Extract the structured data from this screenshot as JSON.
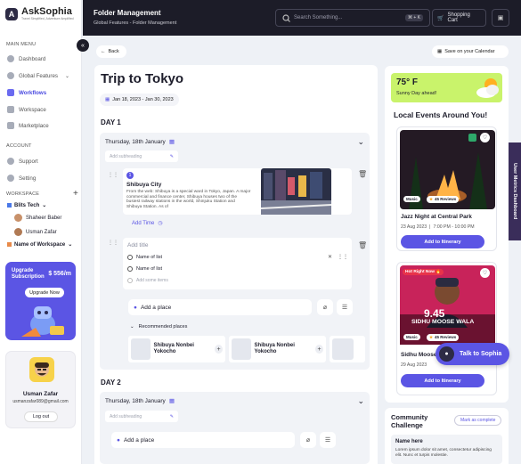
{
  "brand": {
    "name": "AskSophia",
    "tagline": "Travel Simplified, Adventure Amplified"
  },
  "sidebar": {
    "main_menu": "MAIN MENU",
    "main_items": [
      {
        "label": "Dashboard"
      },
      {
        "label": "Global Features"
      },
      {
        "label": "Workflows"
      },
      {
        "label": "Workspace"
      },
      {
        "label": "Marketplace"
      }
    ],
    "account": "ACCOUNT",
    "account_items": [
      {
        "label": "Support"
      },
      {
        "label": "Setting"
      }
    ],
    "workspace": "WORKSPACE",
    "ws1": "Blits Tech",
    "members": [
      "Shaheer Baber",
      "Usman Zafar"
    ],
    "ws2": "Name of Workspace"
  },
  "upgrade": {
    "title": "Upgrade Subscription",
    "price": "$ 556/m",
    "button": "Upgrade Now"
  },
  "user": {
    "name": "Usman Zafar",
    "email": "usmanzafar089@gmail.com",
    "logout": "Log out"
  },
  "topbar": {
    "title": "Folder Management",
    "breadcrumb": "Global Features - Folder Management",
    "search_placeholder": "Search Something...",
    "shortcut": "⌘ + K",
    "cart": "Shopping Cart"
  },
  "toolbar": {
    "back": "Back",
    "save": "Save on your Calendar"
  },
  "trip": {
    "title": "Trip to Tokyo",
    "dates": "Jan 18, 2023 - Jan 30, 2023"
  },
  "day1": {
    "label": "DAY 1",
    "date": "Thursday, 18th January",
    "subheading": "Add subheading",
    "place": {
      "number": "1",
      "name": "Shibuya City",
      "desc": "From the web: Shibuya is a special ward in Tokyo, Japan. A major commercial and finance center, Shibuya houses two of the busiest railway stations in the world, Shinjuku Station and Shibuya Station. As of"
    },
    "add_time": "Add Time",
    "list": {
      "title": "Add title",
      "items": [
        "Name of list",
        "Name of list"
      ],
      "add": "Add some items"
    },
    "add_place": "Add a place",
    "recommended": "Recommended places",
    "rec_places": [
      "Shibuya Nonbei Yokocho",
      "Shibuya Nonbei Yokocho"
    ]
  },
  "day2": {
    "label": "DAY 2",
    "date": "Thursday, 18th January",
    "subheading": "Add subheading",
    "add_place": "Add a place"
  },
  "weather": {
    "temp": "75° F",
    "text": "Sunny Day ahead!"
  },
  "events": {
    "title": "Local Events Around You!",
    "items": [
      {
        "tag": "Music",
        "reviews": "45 Reviews",
        "name": "Jazz Night at Central Park",
        "date": "23 Aug 2023",
        "time": "7:00 PM - 10:00 PM",
        "btn": "Add to Itinerary"
      },
      {
        "badge": "Hot Right Now 🔥",
        "tag": "Music",
        "reviews": "45 Reviews",
        "poster_big": "9.45",
        "poster_name": "SIDHU MOOSE WALA",
        "name": "Sidhu Moose",
        "date": "29 Aug 2023",
        "btn": "Add to Itinerary"
      }
    ]
  },
  "side_tab": "User Metrics Dashboard",
  "talk": "Talk to Sophia",
  "challenge": {
    "title": "Community Challenge",
    "mark": "Mark as complete",
    "name": "Name here",
    "desc": "Lorem ipsum dolor sit amet, consectetur adipiscing elit. Nunc et turpis molestie."
  },
  "colors": {
    "accent": "#5b55e4",
    "dark": "#1c1c28",
    "weather": "#c9f36b"
  }
}
